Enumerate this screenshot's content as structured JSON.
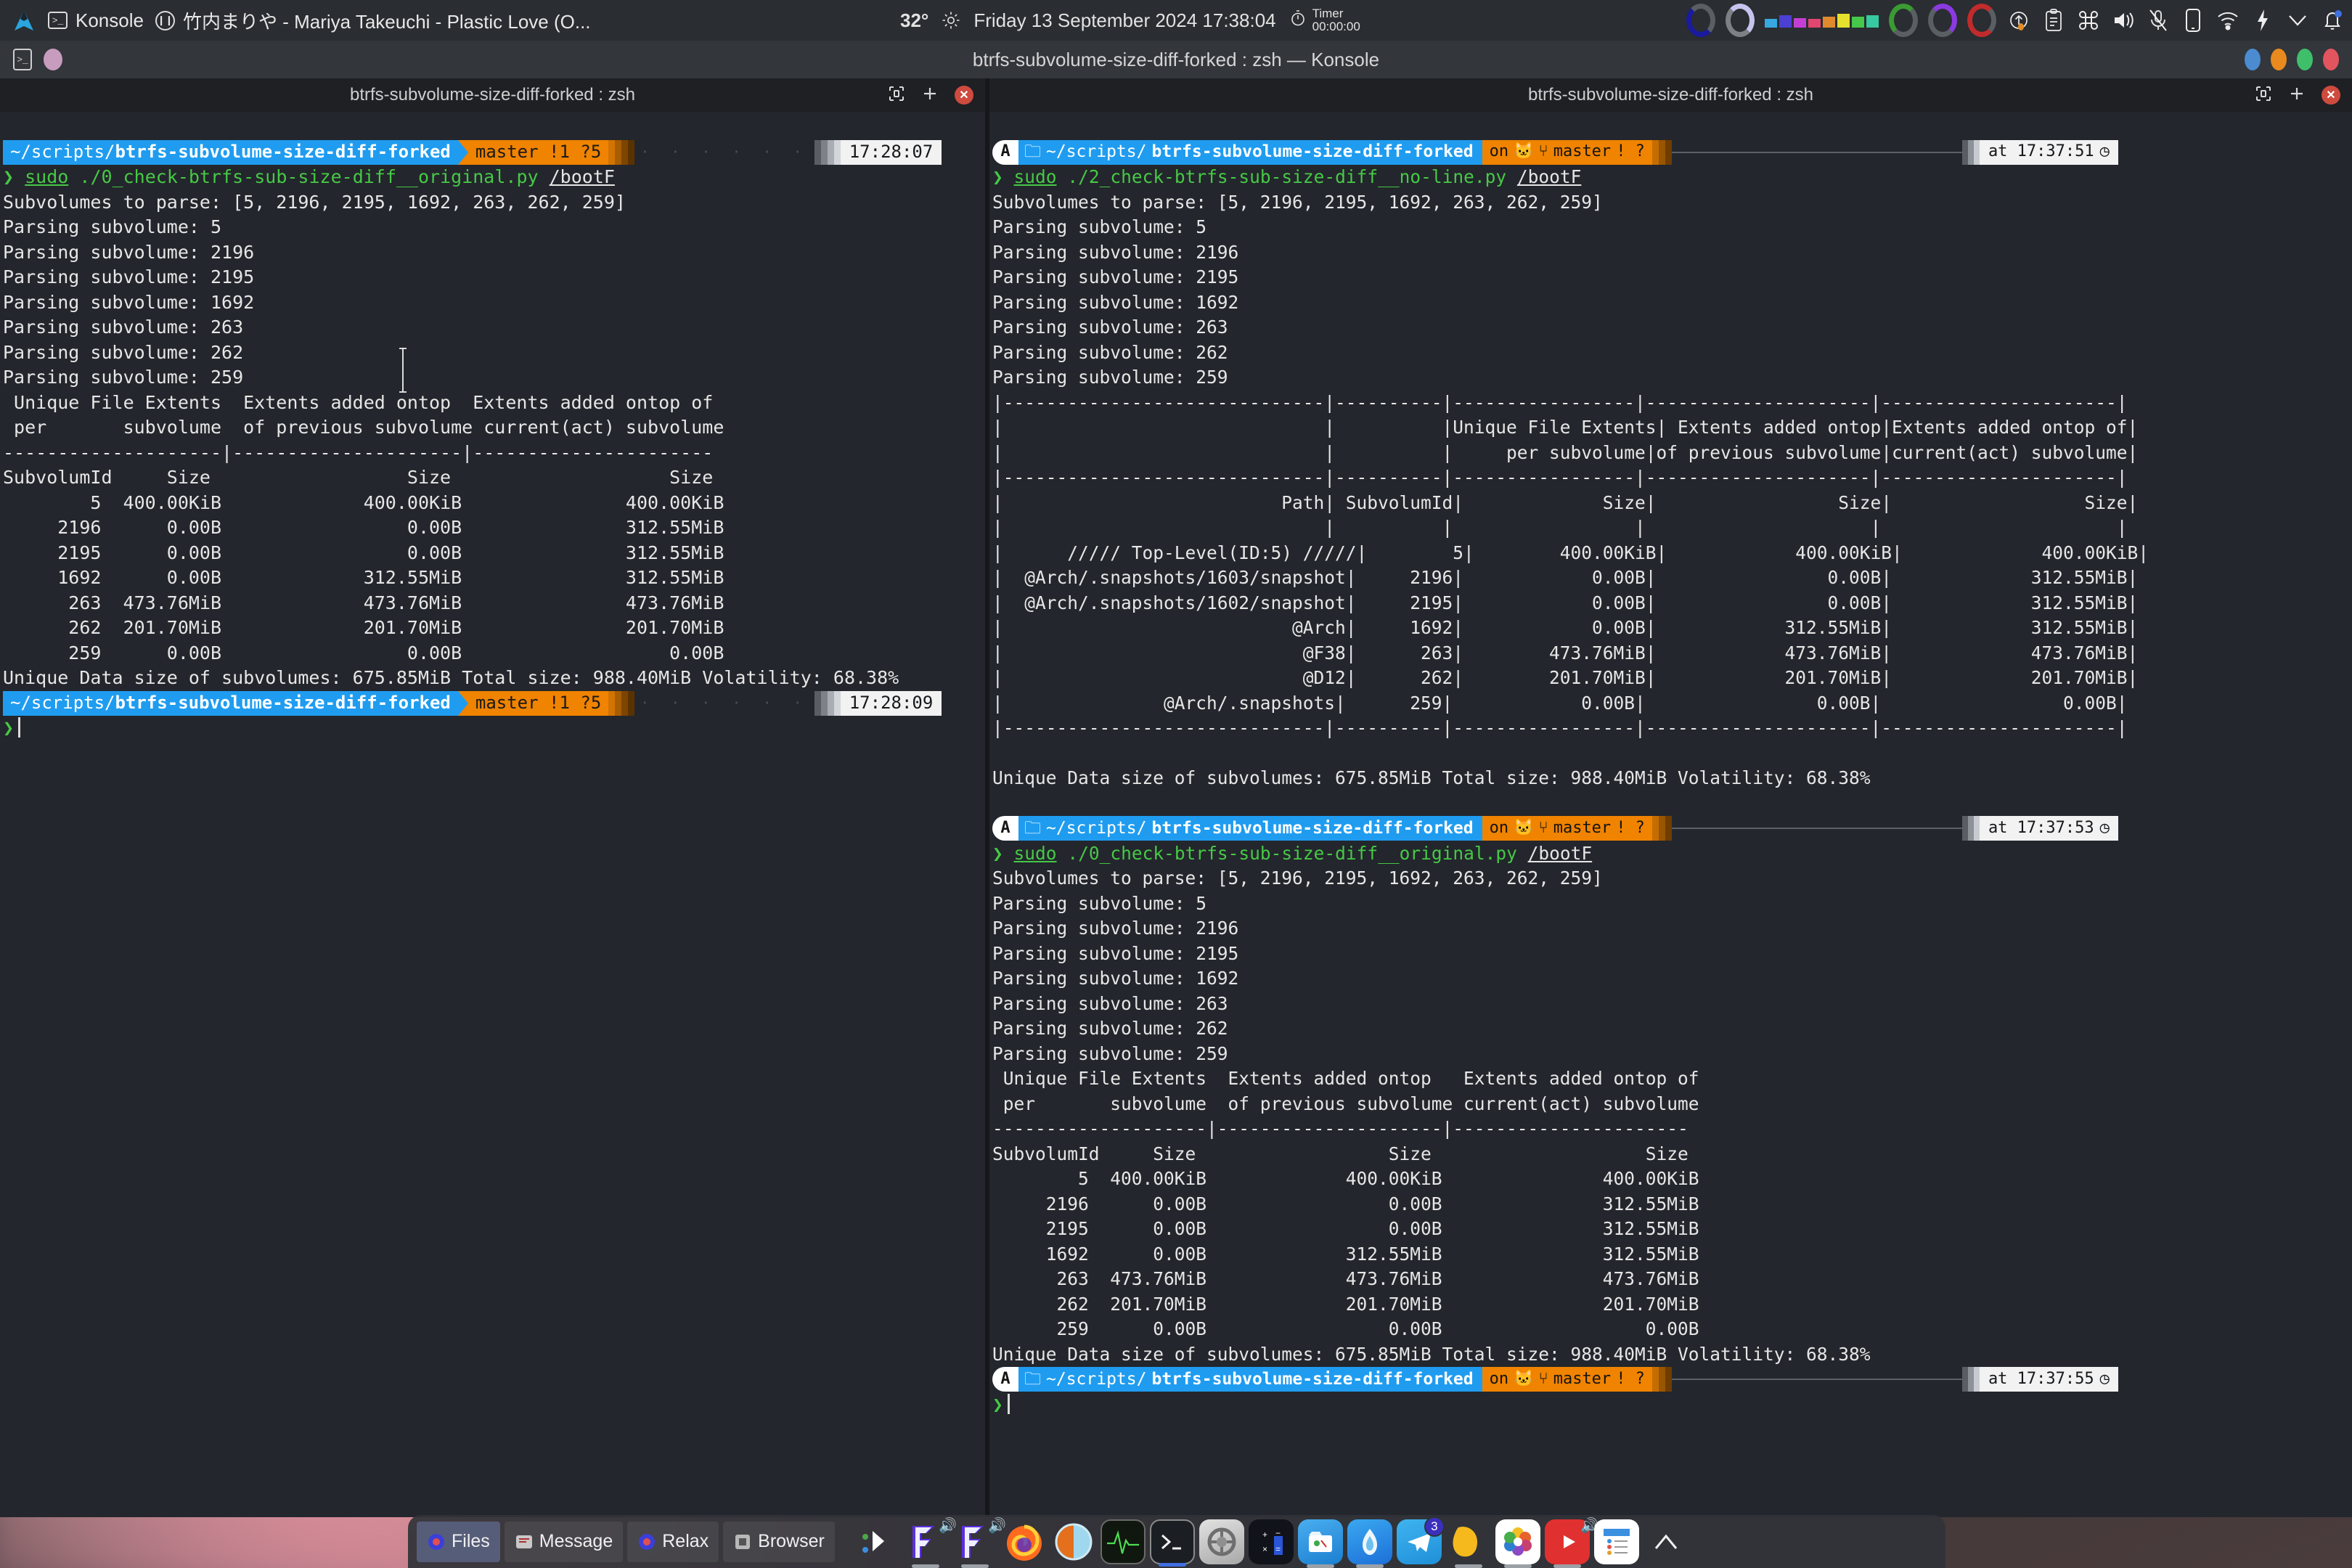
{
  "toppanel": {
    "app_icon": "arch-logo",
    "app_name": "Konsole",
    "media_title": "竹内まりや - Mariya Takeuchi -  Plastic Love (O...",
    "temperature": "32°",
    "datetime": "Friday 13 September 2024 17:38:04",
    "timer_label": "Timer",
    "timer_value": "00:00:00",
    "tray_icons": [
      "navy-ring",
      "lavender-ring",
      "color-swatches",
      "green-ring",
      "purple-ring",
      "red-ring",
      "update-icon",
      "clipboard-icon",
      "keyboard-icon",
      "volume-icon",
      "microphone-muted-icon",
      "phone-icon",
      "wifi-icon",
      "battery-bolt-icon",
      "chevron-down-icon",
      "notification-bell-icon"
    ],
    "swatch_colors": [
      "#37a9e0",
      "#4c3fd4",
      "#c33fd4",
      "#e0466f",
      "#e08a2e",
      "#e5e02e",
      "#46c94a",
      "#37c9a0"
    ]
  },
  "window": {
    "title": "btrfs-subvolume-size-diff-forked : zsh — Konsole",
    "titlebar_icons": [
      "konsole-icon",
      "session-dot"
    ],
    "buttons": [
      "minimize",
      "maximize",
      "restore",
      "close"
    ],
    "button_colors": [
      "#4b8bd0",
      "#e88a1e",
      "#3fbf6a",
      "#e2555f"
    ]
  },
  "panes": {
    "left": {
      "tab_title": "btrfs-subvolume-size-diff-forked : zsh",
      "tab_controls": [
        "split-view-icon",
        "new-tab-icon",
        "close-tab-icon"
      ],
      "prompt1": {
        "path_prefix": "~/scripts/",
        "path_repo": "btrfs-subvolume-size-diff-forked",
        "git": "master !1 ?5",
        "time": "17:28:07"
      },
      "command": {
        "marker": "❯",
        "sudo": "sudo",
        "script": "./0_check-btrfs-sub-size-diff__original.py",
        "arg": "/bootF"
      },
      "output_head": [
        "Subvolumes to parse: [5, 2196, 2195, 1692, 263, 262, 259]",
        "Parsing subvolume: 5",
        "Parsing subvolume: 2196",
        "Parsing subvolume: 2195",
        "Parsing subvolume: 1692",
        "Parsing subvolume: 263",
        "Parsing subvolume: 262",
        "Parsing subvolume: 259"
      ],
      "table": [
        " Unique File Extents  Extents added ontop  Extents added ontop of",
        " per       subvolume  of previous subvolume current(act) subvolume",
        "--------------------|---------------------|----------------------",
        "SubvolumId     Size                  Size                    Size",
        "        5  400.00KiB             400.00KiB               400.00KiB",
        "     2196      0.00B                 0.00B               312.55MiB",
        "     2195      0.00B                 0.00B               312.55MiB",
        "     1692      0.00B             312.55MiB               312.55MiB",
        "      263  473.76MiB             473.76MiB               473.76MiB",
        "      262  201.70MiB             201.70MiB               201.70MiB",
        "      259      0.00B                 0.00B                   0.00B"
      ],
      "summary": "Unique Data size of subvolumes: 675.85MiB Total size: 988.40MiB Volatility: 68.38%",
      "prompt2": {
        "path_prefix": "~/scripts/",
        "path_repo": "btrfs-subvolume-size-diff-forked",
        "git": "master !1 ?5",
        "time": "17:28:09"
      }
    },
    "right": {
      "tab_title": "btrfs-subvolume-size-diff-forked : zsh",
      "tab_controls": [
        "split-view-icon",
        "new-tab-icon",
        "close-tab-icon"
      ],
      "block1": {
        "prompt": {
          "cap": "A",
          "folder_icon": "folder-icon",
          "path_prefix": "~/scripts/",
          "path_repo": "btrfs-subvolume-size-diff-forked",
          "on": "on",
          "git_icons": "cat-icon branch-icon",
          "branch": "master",
          "status": "! ?",
          "time": "at 17:37:51"
        },
        "command": {
          "marker": "❯",
          "sudo": "sudo",
          "script": "./2_check-btrfs-sub-size-diff__no-line.py",
          "arg": "/bootF"
        },
        "output_head": [
          "Subvolumes to parse: [5, 2196, 2195, 1692, 263, 262, 259]",
          "Parsing subvolume: 5",
          "Parsing subvolume: 2196",
          "Parsing subvolume: 2195",
          "Parsing subvolume: 1692",
          "Parsing subvolume: 263",
          "Parsing subvolume: 262",
          "Parsing subvolume: 259"
        ],
        "table": [
          "|------------------------------|----------|-----------------|---------------------|----------------------|",
          "|                              |          |Unique File Extents| Extents added ontop|Extents added ontop of|",
          "|                              |          |     per subvolume|of previous subvolume|current(act) subvolume|",
          "|------------------------------|----------|-----------------|---------------------|----------------------|",
          "|                          Path| SubvolumId|             Size|                 Size|                  Size|",
          "|                              |          |                 |                     |                      |",
          "|                              |          |                 |                     |                      |",
          "|      ///// Top-Level(ID:5) /////|        5|        400.00KiB|            400.00KiB|             400.00KiB|",
          "|  @Arch/.snapshots/1603/snapshot|     2196|            0.00B|                0.00B|             312.55MiB|",
          "|  @Arch/.snapshots/1602/snapshot|     2195|            0.00B|                0.00B|             312.55MiB|",
          "|                           @Arch|     1692|            0.00B|            312.55MiB|             312.55MiB|",
          "|                            @F38|      263|        473.76MiB|            473.76MiB|             473.76MiB|",
          "|                            @D12|      262|        201.70MiB|            201.70MiB|             201.70MiB|",
          "|               @Arch/.snapshots|      259|            0.00B|                0.00B|                 0.00B|",
          "|------------------------------|----------|-----------------|---------------------|----------------------|",
          "|                              |          |                 |                     |                      |"
        ],
        "summary": "Unique Data size of subvolumes: 675.85MiB Total size: 988.40MiB Volatility: 68.38%"
      },
      "block2": {
        "prompt": {
          "cap": "A",
          "folder_icon": "folder-icon",
          "path_prefix": "~/scripts/",
          "path_repo": "btrfs-subvolume-size-diff-forked",
          "on": "on",
          "branch": "master",
          "status": "! ?",
          "time": "at 17:37:53"
        },
        "command": {
          "marker": "❯",
          "sudo": "sudo",
          "script": "./0_check-btrfs-sub-size-diff__original.py",
          "arg": "/bootF"
        },
        "output_head": [
          "Subvolumes to parse: [5, 2196, 2195, 1692, 263, 262, 259]",
          "Parsing subvolume: 5",
          "Parsing subvolume: 2196",
          "Parsing subvolume: 2195",
          "Parsing subvolume: 1692",
          "Parsing subvolume: 263",
          "Parsing subvolume: 262",
          "Parsing subvolume: 259"
        ],
        "table": [
          " Unique File Extents  Extents added ontop   Extents added ontop of",
          " per       subvolume  of previous subvolume current(act) subvolume",
          "--------------------|---------------------|----------------------",
          "SubvolumId     Size                  Size                    Size",
          "        5  400.00KiB             400.00KiB               400.00KiB",
          "     2196      0.00B                 0.00B               312.55MiB",
          "     2195      0.00B                 0.00B               312.55MiB",
          "     1692      0.00B             312.55MiB               312.55MiB",
          "      263  473.76MiB             473.76MiB               473.76MiB",
          "      262  201.70MiB             201.70MiB               201.70MiB",
          "      259      0.00B                 0.00B                   0.00B"
        ],
        "summary": "Unique Data size of subvolumes: 675.85MiB Total size: 988.40MiB Volatility: 68.38%"
      },
      "block3": {
        "prompt": {
          "cap": "A",
          "path_prefix": "~/scripts/",
          "path_repo": "btrfs-subvolume-size-diff-forked",
          "on": "on",
          "branch": "master",
          "status": "! ?",
          "time": "at 17:37:55"
        },
        "marker": "❯"
      }
    }
  },
  "dock": {
    "windows": [
      {
        "label": "Files",
        "icon": "files-icon",
        "active": true
      },
      {
        "label": "Message",
        "icon": "message-icon",
        "active": false
      },
      {
        "label": "Relax",
        "icon": "relax-icon",
        "active": false
      },
      {
        "label": "Browser",
        "icon": "browser-icon",
        "active": false
      }
    ],
    "launchers": [
      {
        "name": "dots-arrow-icon",
        "running": false
      },
      {
        "name": "foobar-player-icon",
        "running": true
      },
      {
        "name": "foobar-player-2-icon",
        "running": true
      },
      {
        "name": "firefox-icon",
        "running": false
      },
      {
        "name": "konqueror-icon",
        "running": false
      },
      {
        "name": "system-monitor-icon",
        "running": false
      },
      {
        "name": "konsole-icon",
        "running": true
      },
      {
        "name": "settings-icon",
        "running": false
      },
      {
        "name": "calculator-icon",
        "running": false
      },
      {
        "name": "dolphin-icon",
        "running": true
      },
      {
        "name": "kate-icon",
        "running": true
      },
      {
        "name": "telegram-icon",
        "running": false,
        "badge": "3"
      },
      {
        "name": "notes-icon",
        "running": true
      },
      {
        "name": "photos-icon",
        "running": true
      },
      {
        "name": "youtube-icon",
        "running": true
      },
      {
        "name": "todo-icon",
        "running": false
      },
      {
        "name": "chevron-up-icon",
        "running": false
      }
    ]
  }
}
